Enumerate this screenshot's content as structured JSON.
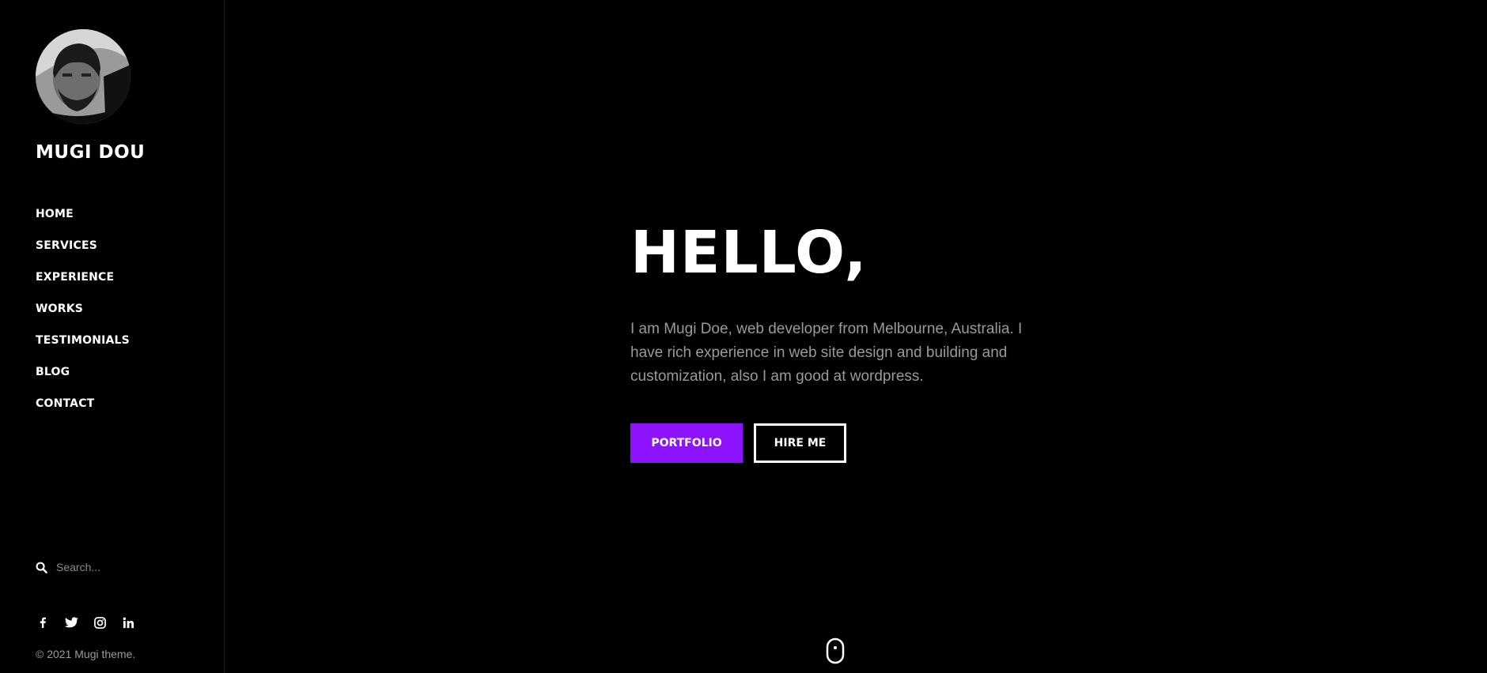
{
  "sidebar": {
    "brand": "MUGI DOU",
    "nav": [
      {
        "label": "HOME"
      },
      {
        "label": "SERVICES"
      },
      {
        "label": "EXPERIENCE"
      },
      {
        "label": "WORKS"
      },
      {
        "label": "TESTIMONIALS"
      },
      {
        "label": "BLOG"
      },
      {
        "label": "CONTACT"
      }
    ],
    "search": {
      "placeholder": "Search...",
      "icon": "search-icon"
    },
    "social": [
      {
        "icon": "facebook-icon",
        "glyph": "f"
      },
      {
        "icon": "twitter-icon",
        "glyph": "t"
      },
      {
        "icon": "instagram-icon",
        "glyph": "ig"
      },
      {
        "icon": "linkedin-icon",
        "glyph": "in"
      }
    ],
    "copyright": "© 2021 Mugi theme."
  },
  "hero": {
    "heading": "HELLO,",
    "intro": "I am Mugi Doe, web developer from Melbourne, Australia. I have rich experience in web site design and building and customization, also I am good at wordpress.",
    "buttons": {
      "primary_label": "PORTFOLIO",
      "secondary_label": "HIRE ME"
    }
  },
  "colors": {
    "background": "#000000",
    "accent": "#8d12fe",
    "text": "#ffffff",
    "muted": "#9a9a9a"
  }
}
